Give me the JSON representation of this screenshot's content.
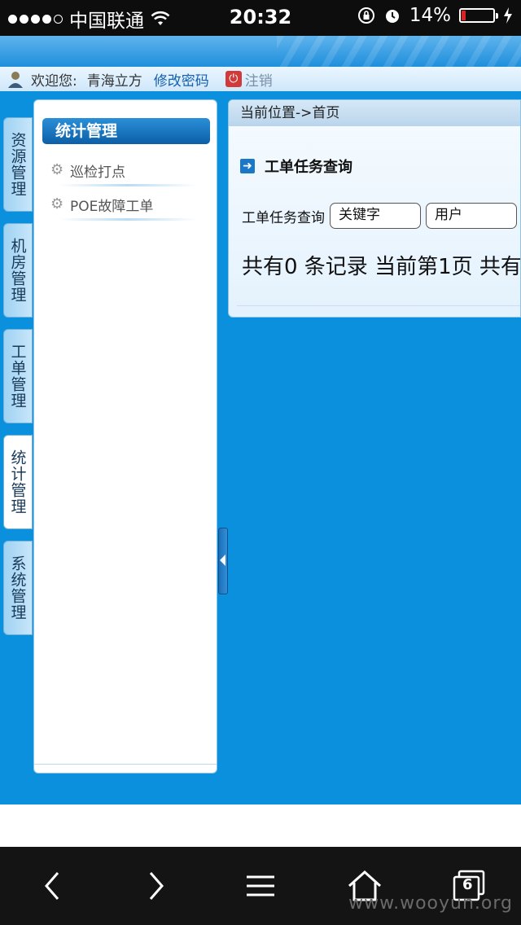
{
  "status_bar": {
    "carrier": "中国联通",
    "time": "20:32",
    "battery": "14%",
    "battery_level": 0.14,
    "signal_bars_filled": 4,
    "signal_bars_total": 5
  },
  "header": {
    "welcome": "欢迎您:",
    "username": "青海立方",
    "change_password": "修改密码",
    "logout": "注销"
  },
  "vertical_tabs": [
    {
      "label": "资源管理",
      "active": false
    },
    {
      "label": "机房管理",
      "active": false
    },
    {
      "label": "工单管理",
      "active": false
    },
    {
      "label": "统计管理",
      "active": true
    },
    {
      "label": "系统管理",
      "active": false
    }
  ],
  "sidebar": {
    "title": "统计管理",
    "items": [
      {
        "label": "巡检打点"
      },
      {
        "label": "POE故障工单"
      }
    ]
  },
  "content": {
    "breadcrumb": "当前位置->首页",
    "section_title": "工单任务查询",
    "query_label": "工单任务查询",
    "keyword_value": "关键字",
    "user_value": "用户",
    "records_text": "共有0 条记录 当前第1页 共有"
  },
  "watermark": "www.wooyun.org",
  "toolbar": {
    "tabs_count": "6"
  },
  "colors": {
    "main_bg": "#0b90de",
    "accent": "#0b5fa8",
    "battery_low": "#e02020"
  }
}
